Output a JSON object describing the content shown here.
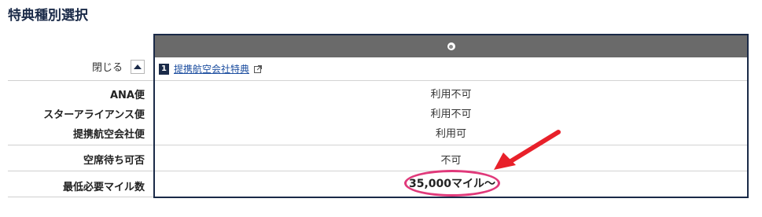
{
  "page": {
    "title": "特典種別選択"
  },
  "labels": {
    "close": "閉じる",
    "ana_flight": "ANA便",
    "star_alliance": "スターアライアンス便",
    "partner_flight": "提携航空会社便",
    "waitlist": "空席待ち可否",
    "min_miles": "最低必要マイル数"
  },
  "plan": {
    "number": "1",
    "name": "提携航空会社特典",
    "ana_flight": "利用不可",
    "star_alliance": "利用不可",
    "partner_flight": "利用可",
    "waitlist": "不可",
    "min_miles": "35,000マイル〜"
  },
  "colors": {
    "navy": "#1a2a48",
    "header_gray": "#6a6a6a",
    "highlight_pink": "#e0397a",
    "arrow_red": "#e8202a",
    "link_blue": "#1e4fa0"
  },
  "icons": [
    "radio-button-icon",
    "external-link-icon",
    "collapse-up-icon",
    "red-arrow-annotation"
  ]
}
